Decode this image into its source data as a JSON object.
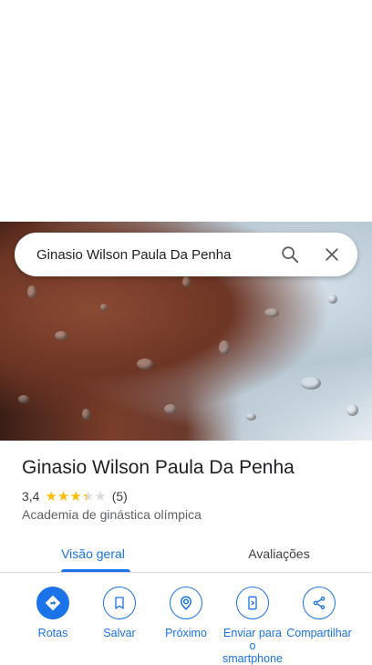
{
  "search": {
    "query": "Ginasio Wilson Paula Da Penha"
  },
  "place": {
    "name": "Ginasio Wilson Paula Da Penha",
    "rating": "3,4",
    "rating_value": 3.4,
    "review_count": "(5)",
    "category": "Academia de ginástica olímpica"
  },
  "tabs": [
    {
      "label": "Visão geral",
      "active": true
    },
    {
      "label": "Avaliações",
      "active": false
    }
  ],
  "actions": [
    {
      "label": "Rotas",
      "icon": "directions-icon"
    },
    {
      "label": "Salvar",
      "icon": "bookmark-icon"
    },
    {
      "label": "Próximo",
      "icon": "nearby-icon"
    },
    {
      "label": "Enviar para o smartphone",
      "icon": "send-to-phone-icon"
    },
    {
      "label": "Compartilhar",
      "icon": "share-icon"
    }
  ],
  "colors": {
    "accent": "#1a73e8",
    "star": "#fbbc04",
    "star_empty": "#dadce0"
  }
}
